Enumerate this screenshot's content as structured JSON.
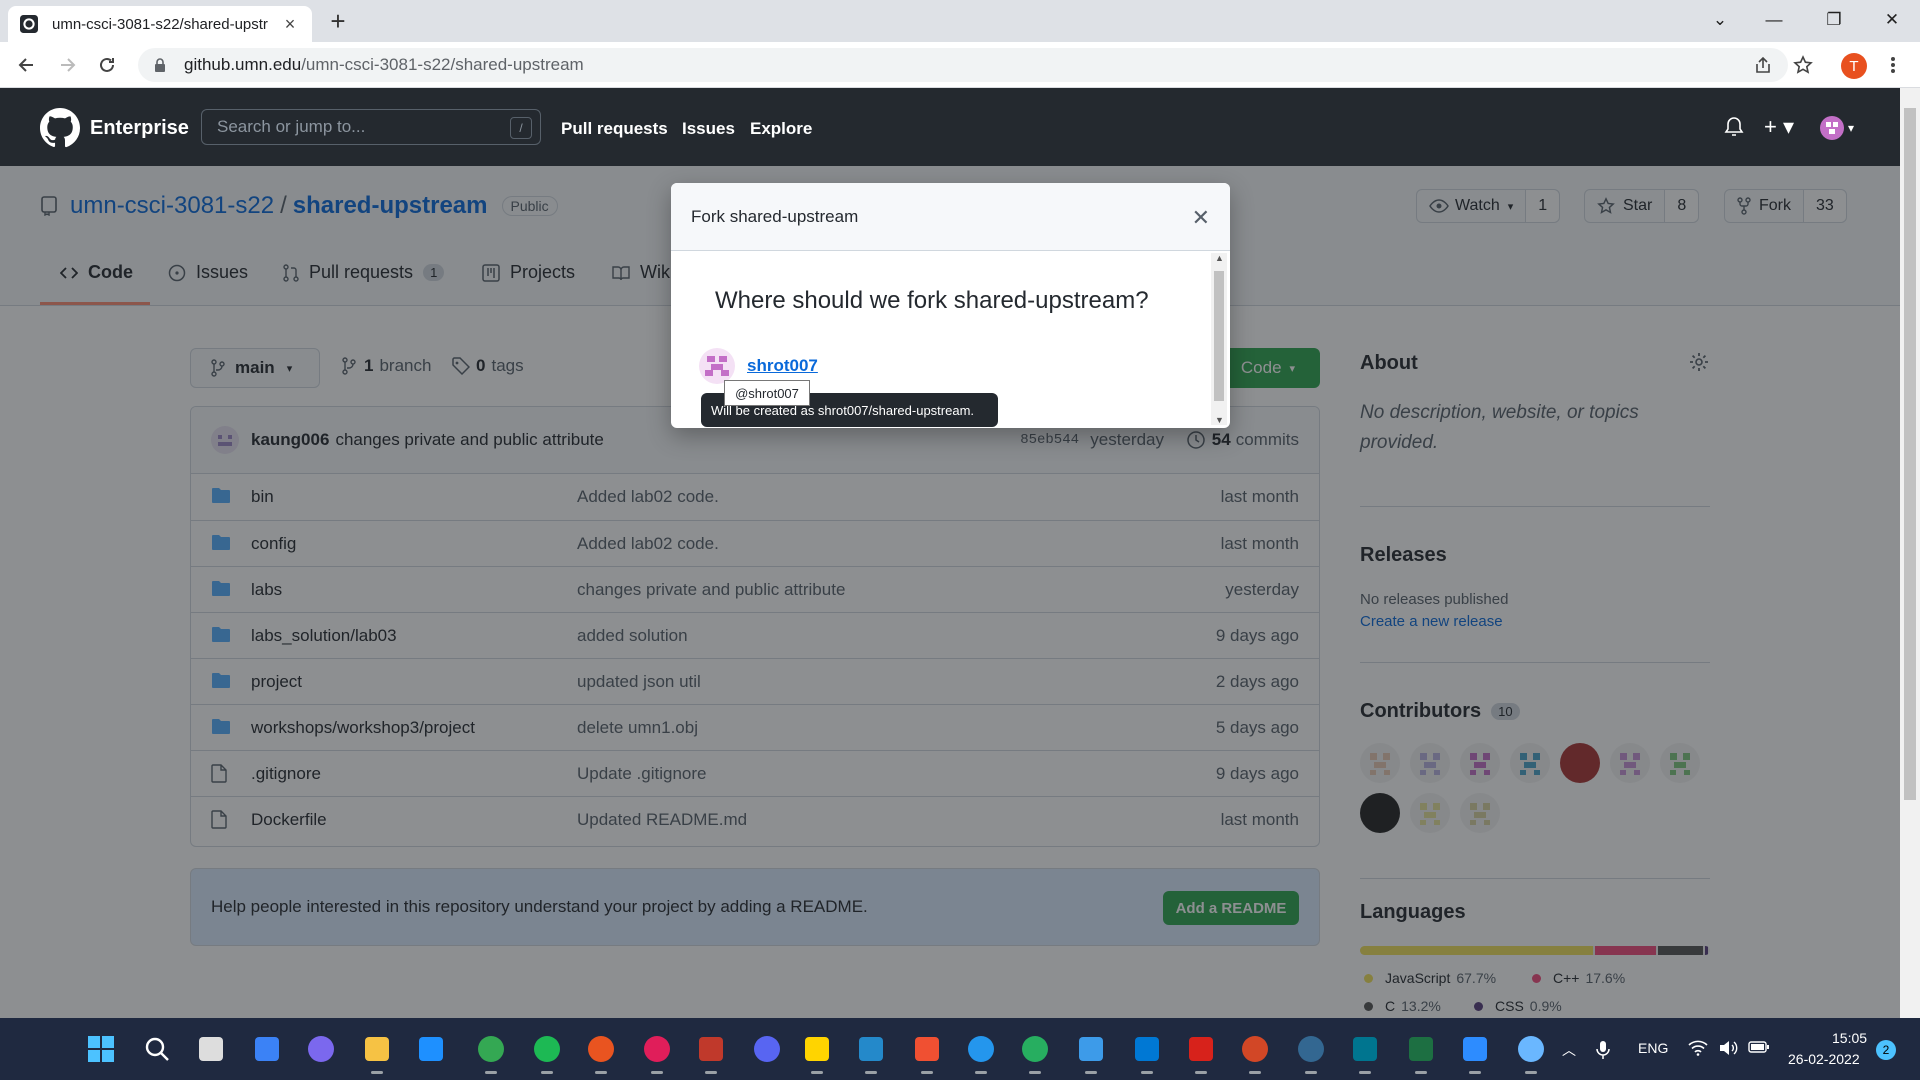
{
  "browser": {
    "tab_title": "umn-csci-3081-s22/shared-upstr",
    "url_domain": "github.umn.edu",
    "url_path": "/umn-csci-3081-s22/shared-upstream",
    "profile_initial": "T"
  },
  "header": {
    "brand": "Enterprise",
    "search_placeholder": "Search or jump to...",
    "slash": "/",
    "nav": [
      "Pull requests",
      "Issues",
      "Explore"
    ]
  },
  "repo": {
    "owner": "umn-csci-3081-s22",
    "sep": "/",
    "name": "shared-upstream",
    "visibility": "Public",
    "watch_label": "Watch",
    "watch_count": "1",
    "star_label": "Star",
    "star_count": "8",
    "fork_label": "Fork",
    "fork_count": "33",
    "tabs": {
      "code": "Code",
      "issues": "Issues",
      "pulls": "Pull requests",
      "pulls_count": "1",
      "projects": "Projects",
      "wiki": "Wiki"
    }
  },
  "main": {
    "branch": "main",
    "branch_count": "1",
    "branch_label": "branch",
    "tag_count": "0",
    "tag_label": "tags",
    "code_button": "Code",
    "commit": {
      "author": "kaung006",
      "message": "changes private and public attribute",
      "sha": "85eb544",
      "time": "yesterday",
      "count": "54",
      "count_label": "commits"
    },
    "files": [
      {
        "name": "bin",
        "message": "Added lab02 code.",
        "age": "last month",
        "type": "folder"
      },
      {
        "name": "config",
        "message": "Added lab02 code.",
        "age": "last month",
        "type": "folder"
      },
      {
        "name": "labs",
        "message": "changes private and public attribute",
        "age": "yesterday",
        "type": "folder"
      },
      {
        "name": "labs_solution/lab03",
        "message": "added solution",
        "age": "9 days ago",
        "type": "folder"
      },
      {
        "name": "project",
        "message": "updated json util",
        "age": "2 days ago",
        "type": "folder"
      },
      {
        "name": "workshops/workshop3/project",
        "message": "delete umn1.obj",
        "age": "5 days ago",
        "type": "folder"
      },
      {
        "name": ".gitignore",
        "message": "Update .gitignore",
        "age": "9 days ago",
        "type": "file"
      },
      {
        "name": "Dockerfile",
        "message": "Updated README.md",
        "age": "last month",
        "type": "file"
      }
    ],
    "readme_text": "Help people interested in this repository understand your project by adding a README.",
    "readme_button": "Add a README"
  },
  "sidebar": {
    "about_title": "About",
    "about_text": "No description, website, or topics provided.",
    "releases_title": "Releases",
    "releases_text": "No releases published",
    "releases_link": "Create a new release",
    "contributors_title": "Contributors",
    "contributors_count": "10",
    "languages_title": "Languages",
    "languages": [
      {
        "name": "JavaScript",
        "percent": "67.7%",
        "value": 67.7,
        "color": "#f1e05a"
      },
      {
        "name": "C++",
        "percent": "17.6%",
        "value": 17.6,
        "color": "#f34b7d"
      },
      {
        "name": "C",
        "percent": "13.2%",
        "value": 13.2,
        "color": "#555555"
      },
      {
        "name": "CSS",
        "percent": "0.9%",
        "value": 0.9,
        "color": "#563d7c"
      }
    ]
  },
  "modal": {
    "title": "Fork shared-upstream",
    "question": "Where should we fork shared-upstream?",
    "user": "shrot007",
    "hover_tip": "@shrot007",
    "tooltip": "Will be created as shrot007/shared-upstream."
  },
  "taskbar": {
    "language": "ENG",
    "time": "15:05",
    "date": "26-02-2022",
    "notification_count": "2"
  },
  "colors": {
    "accent": "#0969da",
    "green": "#2da44e",
    "header": "#24292f",
    "taskbar": "#1f2940"
  }
}
